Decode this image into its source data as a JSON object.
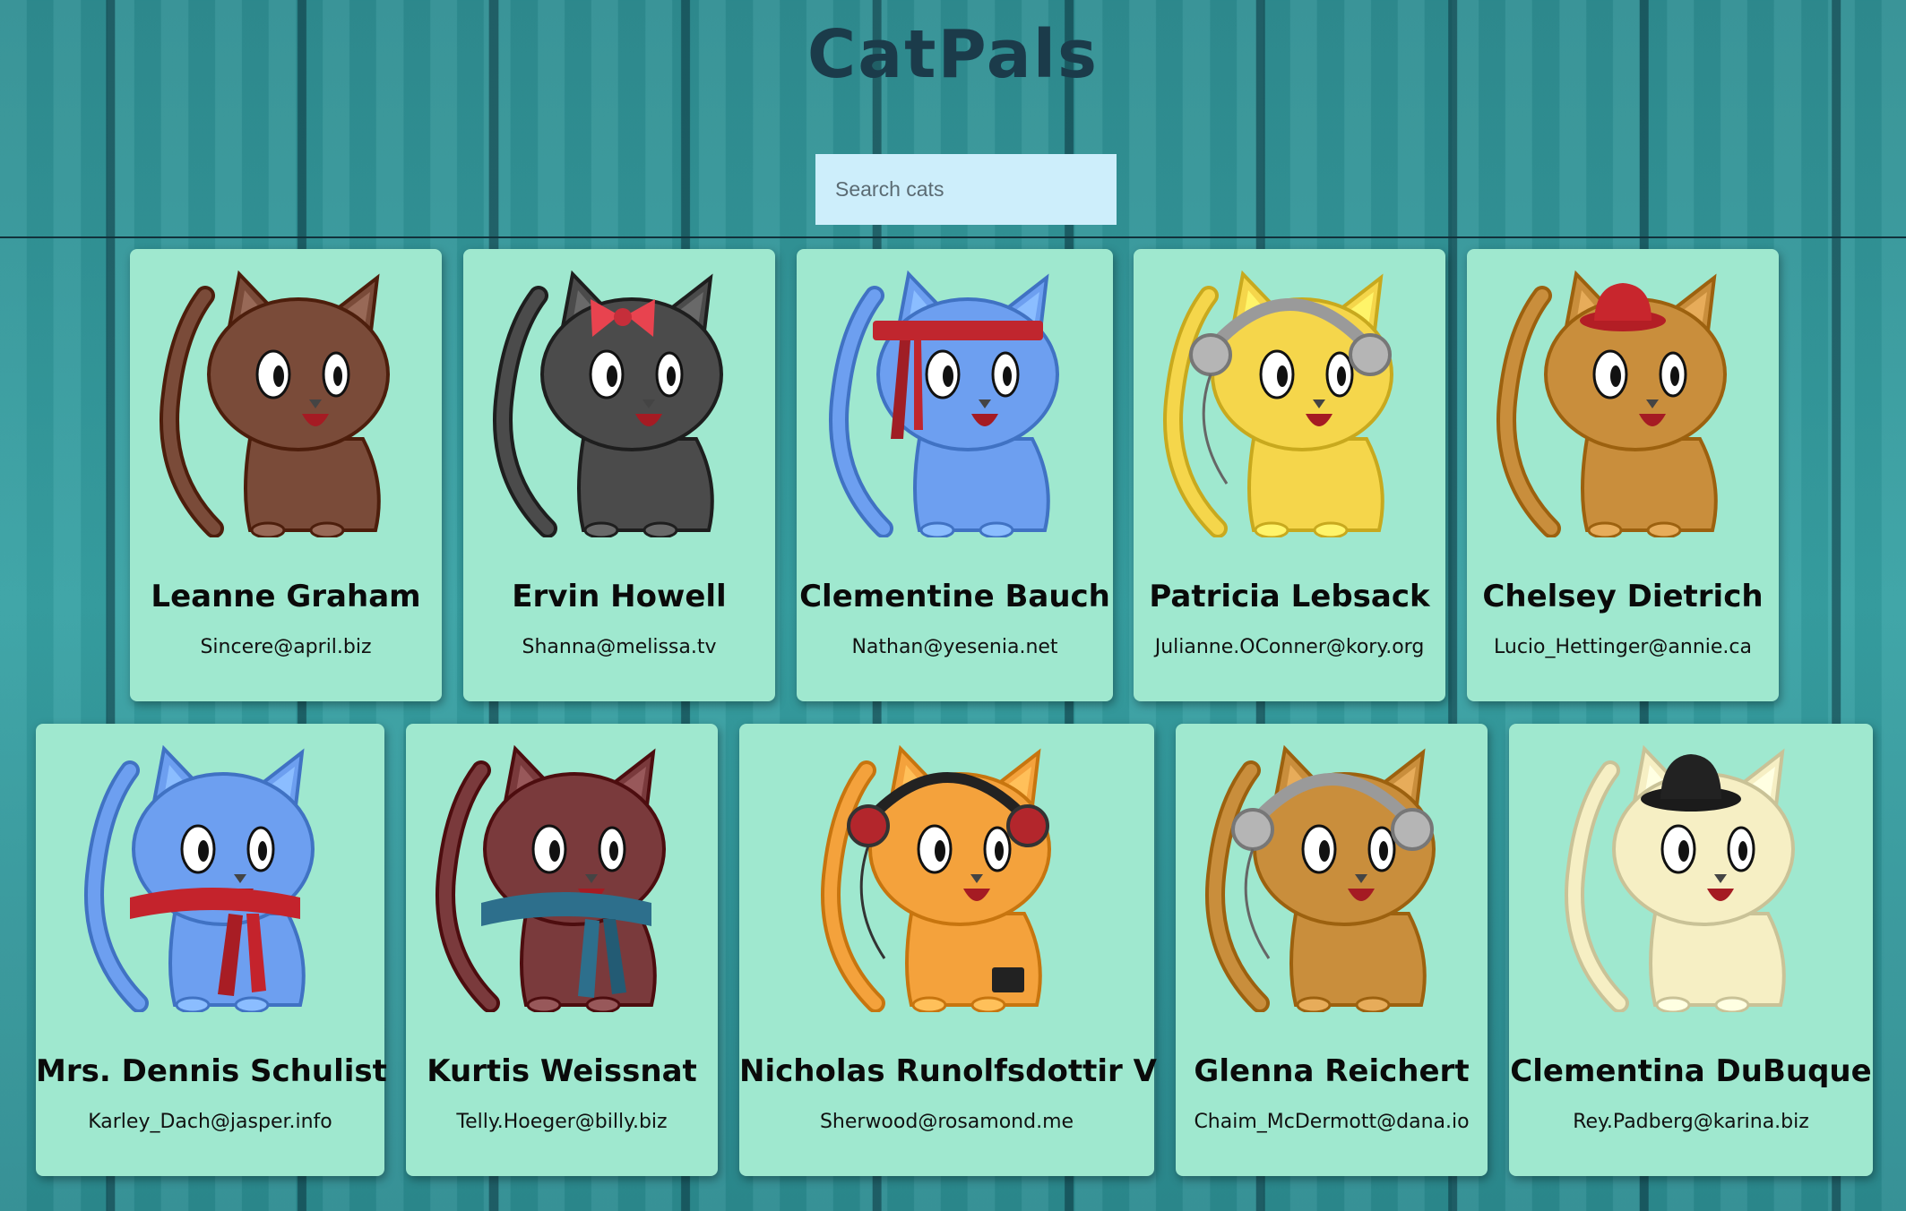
{
  "header": {
    "title": "CatPals"
  },
  "search": {
    "placeholder": "Search cats"
  },
  "colors": {
    "card": "#9fe8cf",
    "search_bg": "#cdeefb",
    "title": "#1b3b4a"
  },
  "cats": [
    {
      "name": "Leanne Graham",
      "email": "Sincere@april.biz",
      "fur": "#7a4b39",
      "accessory": "none"
    },
    {
      "name": "Ervin Howell",
      "email": "Shanna@melissa.tv",
      "fur": "#4b4b4b",
      "accessory": "bow"
    },
    {
      "name": "Clementine Bauch",
      "email": "Nathan@yesenia.net",
      "fur": "#6d9ff0",
      "accessory": "headband"
    },
    {
      "name": "Patricia Lebsack",
      "email": "Julianne.OConner@kory.org",
      "fur": "#f5d64b",
      "accessory": "headphones"
    },
    {
      "name": "Chelsey Dietrich",
      "email": "Lucio_Hettinger@annie.ca",
      "fur": "#c98e3c",
      "accessory": "red-hat"
    },
    {
      "name": "Mrs. Dennis Schulist",
      "email": "Karley_Dach@jasper.info",
      "fur": "#6d9ff0",
      "accessory": "red-scarf"
    },
    {
      "name": "Kurtis Weissnat",
      "email": "Telly.Hoeger@billy.biz",
      "fur": "#7a3a3c",
      "accessory": "blue-scarf"
    },
    {
      "name": "Nicholas Runolfsdottir V",
      "email": "Sherwood@rosamond.me",
      "fur": "#f4a23c",
      "accessory": "red-headphones"
    },
    {
      "name": "Glenna Reichert",
      "email": "Chaim_McDermott@dana.io",
      "fur": "#c98e3c",
      "accessory": "headphones"
    },
    {
      "name": "Clementina DuBuque",
      "email": "Rey.Padberg@karina.biz",
      "fur": "#f6efc4",
      "accessory": "black-hat"
    }
  ]
}
